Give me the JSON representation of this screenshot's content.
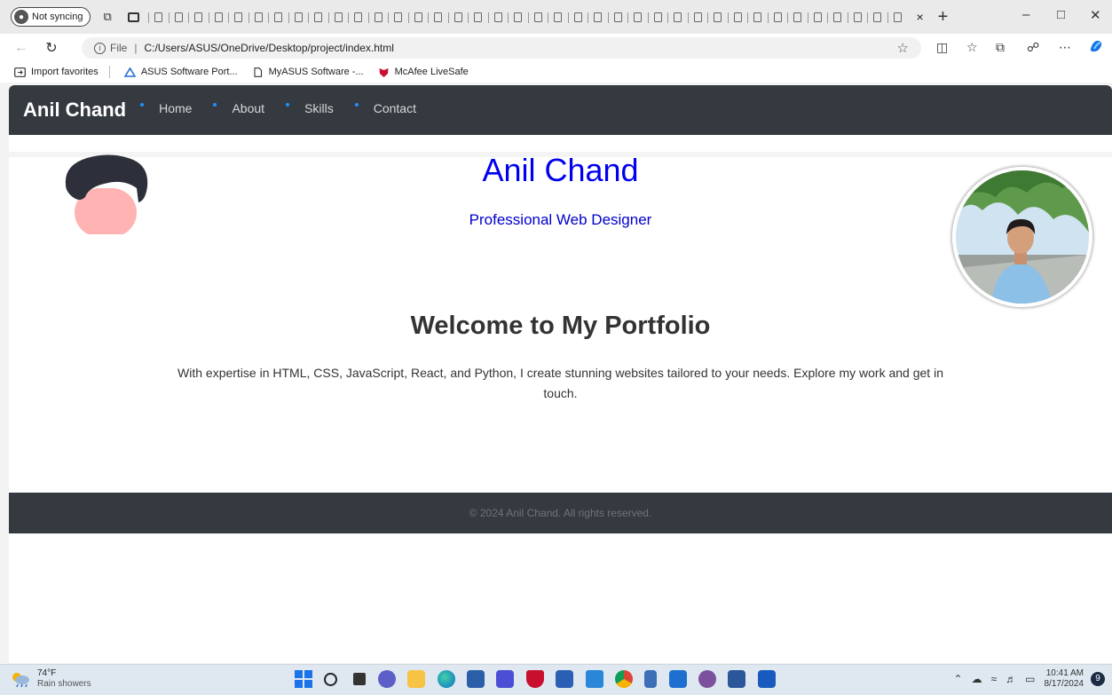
{
  "browser": {
    "sync_label": "Not syncing",
    "url_prefix": "File",
    "url": "C:/Users/ASUS/OneDrive/Desktop/project/index.html",
    "new_tab_glyph": "+",
    "close_tab_glyph": "×",
    "favorites": [
      {
        "label": "Import favorites",
        "icon": "import-favorites-icon"
      },
      {
        "label": "ASUS Software Port...",
        "icon": "asus-logo-icon"
      },
      {
        "label": "MyASUS Software -...",
        "icon": "page-icon"
      },
      {
        "label": "McAfee LiveSafe",
        "icon": "mcafee-shield-icon"
      }
    ]
  },
  "site": {
    "brand": "Anil Chand",
    "nav": [
      {
        "label": "Home"
      },
      {
        "label": "About"
      },
      {
        "label": "Skills"
      },
      {
        "label": "Contact"
      }
    ],
    "hero_name": "Anil Chand",
    "hero_subtitle": "Professional Web Designer",
    "welcome_title": "Welcome to My Portfolio",
    "intro_text": "With expertise in HTML, CSS, JavaScript, React, and Python, I create stunning websites tailored to your needs. Explore my work and get in touch.",
    "footer_text": "© 2024 Anil Chand. All rights reserved.",
    "colors": {
      "nav_bg": "#343a40",
      "hero_name": "#0000ee",
      "nav_dot": "#1e90ff"
    }
  },
  "taskbar": {
    "temperature": "74°F",
    "weather_condition": "Rain showers",
    "time": "10:41 AM",
    "date": "8/17/2024",
    "notification_count": "9"
  }
}
